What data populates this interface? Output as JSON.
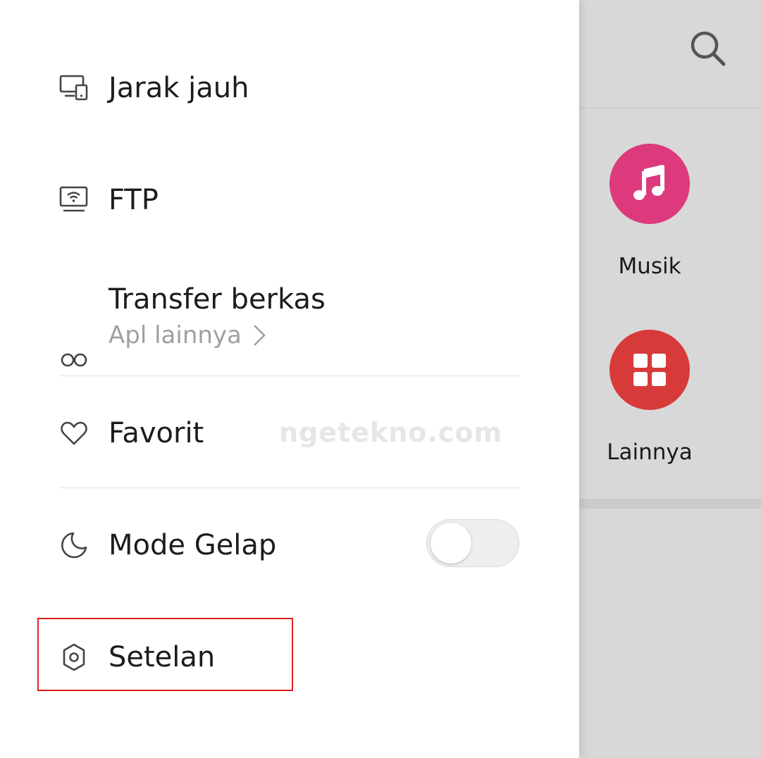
{
  "drawer": {
    "items": [
      {
        "label": "Jarak jauh",
        "icon": "remote-devices-icon"
      },
      {
        "label": "FTP",
        "icon": "ftp-wifi-monitor-icon"
      },
      {
        "label": "Transfer berkas",
        "icon": "infinity-link-icon",
        "sublabel": "Apl lainnya"
      },
      {
        "label": "Favorit",
        "icon": "heart-icon"
      },
      {
        "label": "Mode Gelap",
        "icon": "moon-icon",
        "toggle_on": false
      },
      {
        "label": "Setelan",
        "icon": "gear-icon",
        "highlighted": true
      }
    ]
  },
  "watermark": "ngetekno.com",
  "background_app": {
    "search_icon": "search-icon",
    "categories": [
      {
        "label": "Musik",
        "icon": "music-note-icon",
        "color": "#dc3a7c"
      },
      {
        "label": "Lainnya",
        "icon": "grid-icon",
        "color": "#d83a3a"
      }
    ]
  },
  "colors": {
    "highlight_box": "#e02020",
    "panel_bg": "#d8d8d8"
  }
}
